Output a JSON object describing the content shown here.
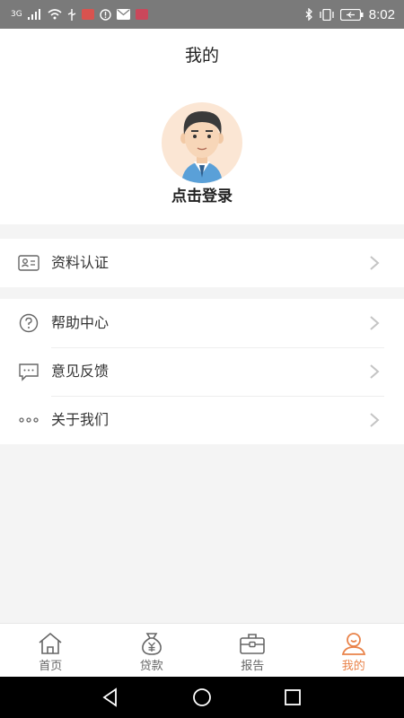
{
  "status_bar": {
    "network": "3G",
    "time": "8:02",
    "icons": [
      "signal-icon",
      "wifi-icon",
      "usb-icon",
      "home-icon",
      "alert-icon",
      "mail-icon",
      "notification-icon",
      "bluetooth-icon",
      "vibrate-icon",
      "battery-icon"
    ]
  },
  "header": {
    "title": "我的"
  },
  "profile": {
    "login_text": "点击登录",
    "avatar": "avatar-icon"
  },
  "menu_group_1": [
    {
      "label": "资料认证",
      "icon": "id-card-icon"
    }
  ],
  "menu_group_2": [
    {
      "label": "帮助中心",
      "icon": "help-icon"
    },
    {
      "label": "意见反馈",
      "icon": "feedback-icon"
    },
    {
      "label": "关于我们",
      "icon": "about-icon"
    }
  ],
  "tabbar": {
    "tabs": [
      {
        "label": "首页",
        "icon": "home-icon"
      },
      {
        "label": "贷款",
        "icon": "money-bag-icon"
      },
      {
        "label": "报告",
        "icon": "briefcase-icon"
      },
      {
        "label": "我的",
        "icon": "user-icon",
        "active": true
      }
    ],
    "active_color": "#e9834a"
  },
  "nav_bar": {
    "buttons": [
      "back-icon",
      "home-circle-icon",
      "recents-icon"
    ]
  }
}
